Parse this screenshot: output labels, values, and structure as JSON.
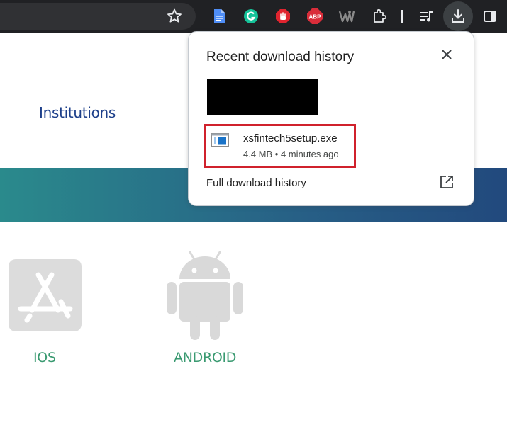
{
  "toolbar": {
    "icons": [
      "star-icon",
      "docs-extension-icon",
      "grammarly-icon",
      "stop-hand-icon",
      "adblock-plus-icon",
      "w-extension-icon",
      "extensions-puzzle-icon",
      "media-playlist-icon",
      "download-icon",
      "side-panel-icon"
    ],
    "abp_label": "ABP"
  },
  "page": {
    "nav_link": "Institutions",
    "banner_colors": [
      "#2a8a8c",
      "#22497d"
    ],
    "stores": [
      {
        "label": "IOS",
        "icon": "app-store-icon"
      },
      {
        "label": "ANDROID",
        "icon": "android-icon"
      }
    ],
    "store_label_color": "#3a9a71"
  },
  "download_bubble": {
    "title": "Recent download history",
    "item": {
      "file_name": "xsfintech5setup.exe",
      "meta": "4.4 MB • 4 minutes ago",
      "icon": "exe-file-icon"
    },
    "full_history_label": "Full download history",
    "highlight_color": "#d0212c"
  }
}
